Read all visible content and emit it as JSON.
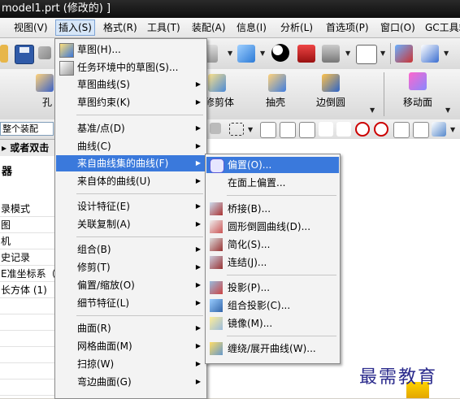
{
  "window": {
    "title": "model1.prt (修改的) ]"
  },
  "menubar": {
    "items": [
      {
        "label": "视图(V)"
      },
      {
        "label": "插入(S)"
      },
      {
        "label": "格式(R)"
      },
      {
        "label": "工具(T)"
      },
      {
        "label": "装配(A)"
      },
      {
        "label": "信息(I)"
      },
      {
        "label": "分析(L)"
      },
      {
        "label": "首选项(P)"
      },
      {
        "label": "窗口(O)"
      },
      {
        "label": "GC工具箱"
      }
    ]
  },
  "toolbar2": {
    "hole": "孔",
    "trim_body": "修剪体",
    "shell": "抽壳",
    "edge_blend": "边倒圆",
    "move_face": "移动面"
  },
  "toolbar3": {
    "filter_value": "整个装配"
  },
  "left_panel": {
    "hint": "或者双击",
    "header": "器",
    "rows": [
      "录模式",
      "图",
      "机",
      "史记录",
      "E准坐标系（",
      "长方体 (1)",
      "",
      "",
      "",
      "",
      "",
      "",
      ""
    ]
  },
  "insert_menu": {
    "items": [
      {
        "label": "草图(H)...",
        "icon": "sketch-icon",
        "submenu": false
      },
      {
        "label": "任务环境中的草图(S)...",
        "icon": "sketch-in-task-icon",
        "submenu": false
      },
      {
        "label": "草图曲线(S)",
        "icon": "",
        "submenu": true
      },
      {
        "label": "草图约束(K)",
        "icon": "",
        "submenu": true
      },
      {
        "label": "基准/点(D)",
        "icon": "",
        "submenu": true
      },
      {
        "label": "曲线(C)",
        "icon": "",
        "submenu": true
      },
      {
        "label": "来自曲线集的曲线(F)",
        "icon": "",
        "submenu": true
      },
      {
        "label": "来自体的曲线(U)",
        "icon": "",
        "submenu": true
      },
      {
        "label": "设计特征(E)",
        "icon": "",
        "submenu": true
      },
      {
        "label": "关联复制(A)",
        "icon": "",
        "submenu": true
      },
      {
        "label": "组合(B)",
        "icon": "",
        "submenu": true
      },
      {
        "label": "修剪(T)",
        "icon": "",
        "submenu": true
      },
      {
        "label": "偏置/缩放(O)",
        "icon": "",
        "submenu": true
      },
      {
        "label": "细节特征(L)",
        "icon": "",
        "submenu": true
      },
      {
        "label": "曲面(R)",
        "icon": "",
        "submenu": true
      },
      {
        "label": "网格曲面(M)",
        "icon": "",
        "submenu": true
      },
      {
        "label": "扫掠(W)",
        "icon": "",
        "submenu": true
      },
      {
        "label": "弯边曲面(G)",
        "icon": "",
        "submenu": true
      }
    ]
  },
  "sub_menu": {
    "items": [
      {
        "label": "偏置(O)...",
        "icon": "offset-curve-icon"
      },
      {
        "label": "在面上偏置...",
        "icon": ""
      },
      {
        "label": "桥接(B)...",
        "icon": "bridge-curve-icon"
      },
      {
        "label": "圆形倒圆曲线(D)...",
        "icon": "circular-blend-icon"
      },
      {
        "label": "简化(S)...",
        "icon": "simplify-icon"
      },
      {
        "label": "连结(J)...",
        "icon": "join-curve-icon"
      },
      {
        "label": "投影(P)...",
        "icon": "project-curve-icon"
      },
      {
        "label": "组合投影(C)...",
        "icon": "combined-projection-icon"
      },
      {
        "label": "镜像(M)...",
        "icon": "mirror-curve-icon"
      },
      {
        "label": "缠绕/展开曲线(W)...",
        "icon": "wrap-unwrap-icon"
      }
    ]
  },
  "watermark": "最需教育",
  "colors": {
    "highlight": "#3a79dc",
    "title_bg": "#111111",
    "menu_bg": "#f3f3f3"
  }
}
